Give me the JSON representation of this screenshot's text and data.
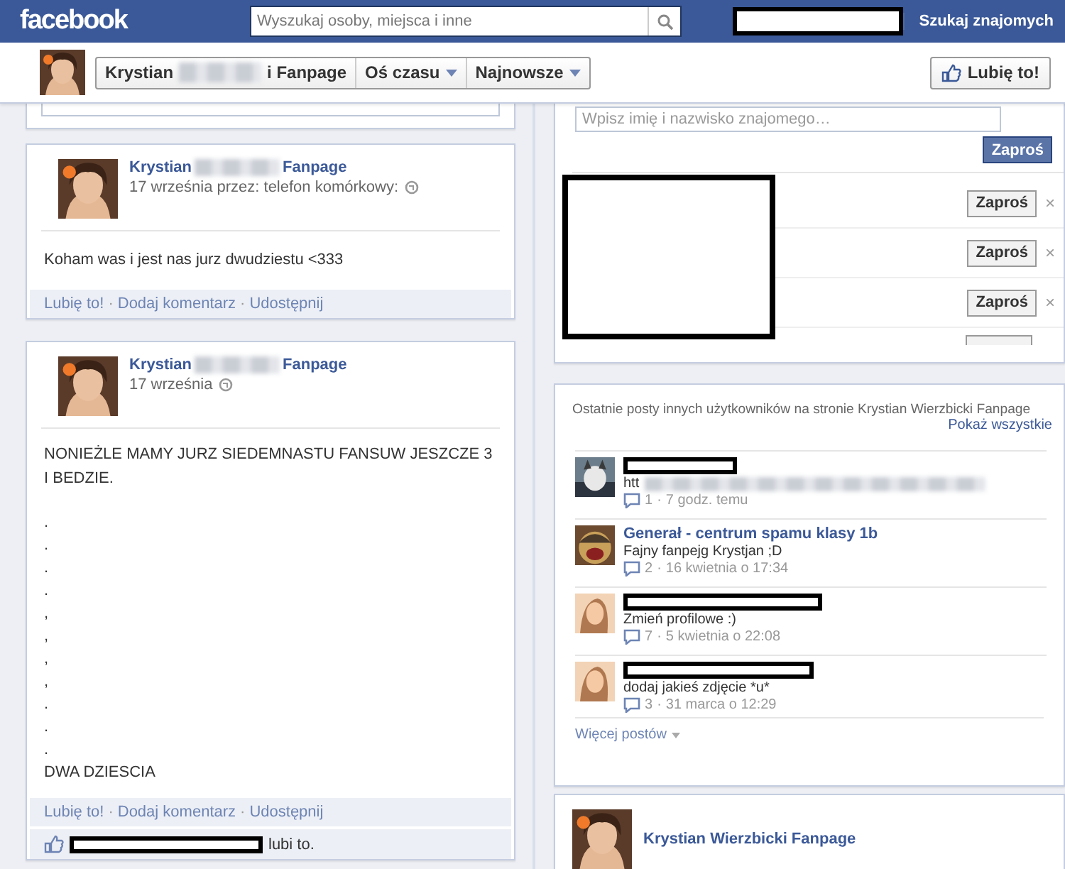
{
  "top_bar": {
    "logo": "facebook",
    "search": {
      "placeholder": "Wyszukaj osoby, miejsca i inne"
    },
    "find_friends": "Szukaj znajomych"
  },
  "page_header": {
    "crumbs": [
      {
        "kind": "page",
        "label_start": "Krystian",
        "label_end": "i Fanpage"
      },
      {
        "kind": "menu",
        "label": "Oś czasu"
      },
      {
        "kind": "menu",
        "label": "Najnowsze"
      }
    ],
    "like_button": "Lubię to!"
  },
  "posts": [
    {
      "author_start": "Krystian",
      "author_end": "Fanpage",
      "meta": "17 września przez: telefon komórkowy:",
      "paragraphs": [
        "Koham was i jest nas jurz dwudziestu <333"
      ],
      "actions": [
        {
          "kind": "link",
          "label": "Lubię to!"
        },
        {
          "kind": "separator",
          "label": "·"
        },
        {
          "kind": "link",
          "label": "Dodaj komentarz"
        },
        {
          "kind": "separator",
          "label": "·"
        },
        {
          "kind": "link",
          "label": "Udostępnij"
        }
      ]
    },
    {
      "author_start": "Krystian",
      "author_end": "Fanpage",
      "meta": "17 września",
      "paragraphs": [
        "NONIEŻLE MAMY JURZ SIEDEMNASTU FANSUW JESZCZE 3 I BEDZIE.",
        ".",
        ".",
        ".",
        ".",
        ",",
        ",",
        ",",
        ",",
        ".",
        ".",
        ".",
        "DWA DZIESCIA"
      ],
      "actions": [
        {
          "kind": "link",
          "label": "Lubię to!"
        },
        {
          "kind": "separator",
          "label": "·"
        },
        {
          "kind": "link",
          "label": "Dodaj komentarz"
        },
        {
          "kind": "separator",
          "label": "·"
        },
        {
          "kind": "link",
          "label": "Udostępnij"
        }
      ],
      "likes": "lubi to."
    }
  ],
  "invite_card": {
    "placeholder": "Wpisz imię i nazwisko znajomego…",
    "invite_button": "Zaproś",
    "suggestions": [
      {
        "button": "Zaproś",
        "close": "×"
      },
      {
        "button": "Zaproś",
        "close": "×"
      },
      {
        "button": "Zaproś",
        "close": "×"
      }
    ]
  },
  "recent_posts": {
    "title": "Ostatnie posty innych użytkowników na stronie Krystian Wierzbicki Fanpage",
    "show_all": "Pokaż wszystkie",
    "items": [
      {
        "kind": "redacted",
        "text": "htt",
        "blurred": true,
        "comments": "1",
        "separator": "·",
        "time": "7 godz. temu"
      },
      {
        "kind": "named",
        "author": "Generał - centrum spamu klasy 1b",
        "text": "Fajny fanpejg Krystjan ;D",
        "blurred": false,
        "comments": "2",
        "separator": "·",
        "time": "16 kwietnia o 17:34"
      },
      {
        "kind": "redacted",
        "text": "Zmień profilowe :)",
        "blurred": false,
        "comments": "7",
        "separator": "·",
        "time": "5 kwietnia o 22:08"
      },
      {
        "kind": "redacted",
        "text": "dodaj jakieś zdjęcie *u*",
        "blurred": false,
        "comments": "3",
        "separator": "·",
        "time": "31 marca o 12:29"
      }
    ],
    "more": "Więcej postów"
  },
  "bottom_post": {
    "author": "Krystian Wierzbicki Fanpage"
  }
}
